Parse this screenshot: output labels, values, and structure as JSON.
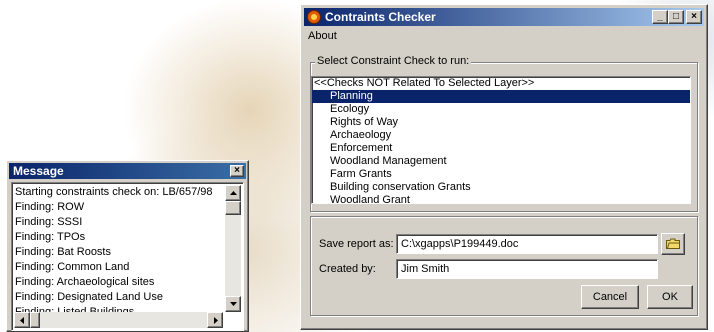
{
  "message_window": {
    "title": "Message",
    "close_glyph": "×",
    "lines": [
      "Starting constraints check on: LB/657/98",
      "Finding: ROW",
      "Finding: SSSI",
      "Finding: TPOs",
      "Finding: Bat Roosts",
      "Finding: Common Land",
      "Finding: Archaeological sites",
      "Finding: Designated Land Use",
      "Finding: Listed Buildings"
    ]
  },
  "checker_window": {
    "title": "Contraints Checker",
    "minimize_glyph": "_",
    "maximize_glyph": "□",
    "close_glyph": "×",
    "menu": [
      "About"
    ],
    "group_label": "Select Constraint Check to run:",
    "list_header": "<<Checks NOT Related To Selected Layer>>",
    "list_items": [
      "Planning",
      "Ecology",
      "Rights of Way",
      "Archaeology",
      "Enforcement",
      "Woodland Management",
      "Farm Grants",
      "Building conservation Grants",
      "Woodland Grant"
    ],
    "selected_item": "Planning",
    "save_label": "Save report as:",
    "save_value": "C:\\xgapps\\P199449.doc",
    "created_label": "Created by:",
    "created_value": "Jim Smith",
    "cancel_label": "Cancel",
    "ok_label": "OK"
  },
  "colors": {
    "titlebar_active": "#0a246a",
    "selection": "#0a246a",
    "face": "#d4d0c8"
  }
}
